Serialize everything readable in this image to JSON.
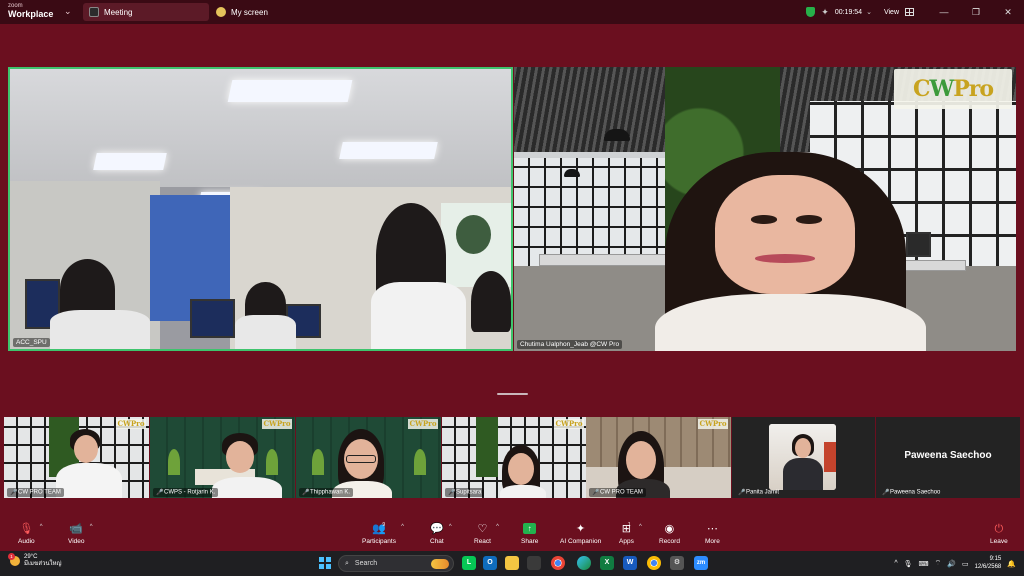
{
  "window": {
    "brand_top": "zoom",
    "brand_main": "Workplace",
    "tabs": [
      {
        "label": "Meeting"
      },
      {
        "label": "My screen"
      }
    ],
    "timer": "00:19:54",
    "view_label": "View"
  },
  "main_videos": [
    {
      "name": "ACC_SPU"
    },
    {
      "name": "Chutima  Ualphon_Jeab @CW Pro"
    }
  ],
  "logo": {
    "part1": "C",
    "part2": "W",
    "part3": "Pro"
  },
  "thumbnail_logo": "CWPro",
  "thumbnails": [
    {
      "name": "CW PRO TEAM"
    },
    {
      "name": "CWPS - Rotjarin K."
    },
    {
      "name": "Thipphawan K."
    },
    {
      "name": "Supitsara"
    },
    {
      "name": "CW PRO TEAM"
    },
    {
      "name": "Panita Jamit"
    },
    {
      "name": "Paweena Saechoo",
      "display_name": "Paweena Saechoo"
    }
  ],
  "toolbar": {
    "audio": "Audio",
    "video": "Video",
    "participants": "Participants",
    "participants_count": "9",
    "chat": "Chat",
    "react": "React",
    "share": "Share",
    "ai_companion": "AI Companion",
    "apps": "Apps",
    "apps_count": "1",
    "record": "Record",
    "more": "More",
    "leave": "Leave"
  },
  "taskbar": {
    "weather_temp": "29°C",
    "weather_desc": "มีเมฆส่วนใหญ่",
    "weather_badge": "1",
    "search_label": "Search",
    "time": "9:15",
    "date": "12/6/2568"
  },
  "colors": {
    "meeting_bg": "#6b0f1f",
    "active_speaker": "#3ec46d",
    "share_green": "#22b34e",
    "leave_red": "#ff5c5c"
  }
}
